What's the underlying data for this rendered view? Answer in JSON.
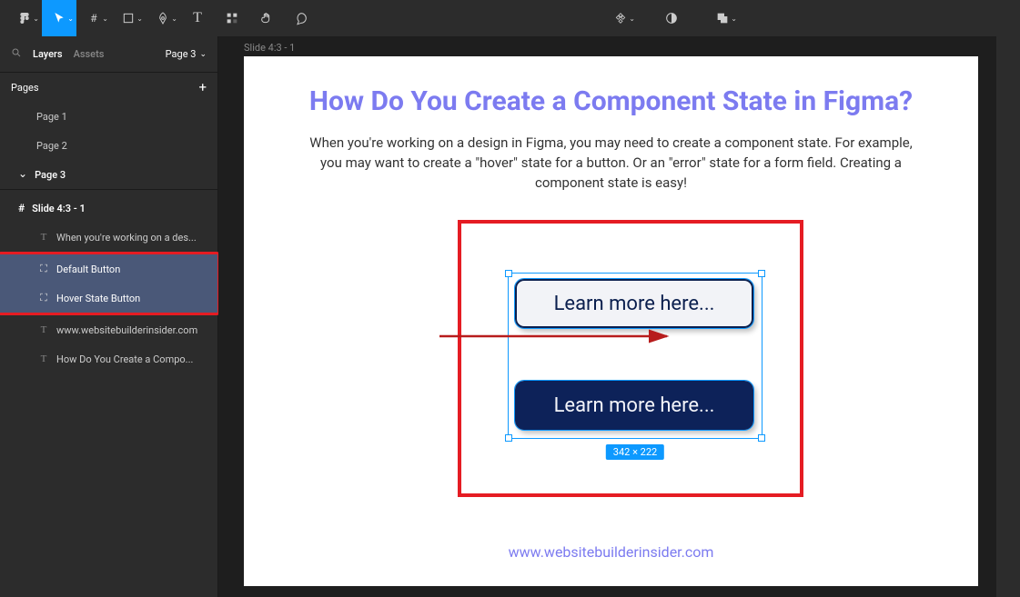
{
  "toolbar": {
    "tools": [
      "figma-menu",
      "move",
      "frame",
      "shape",
      "pen",
      "text",
      "resources",
      "hand",
      "comment"
    ]
  },
  "sidebar": {
    "tabs": {
      "layers": "Layers",
      "assets": "Assets"
    },
    "page_selector": "Page 3",
    "pages_header": "Pages",
    "pages": [
      "Page 1",
      "Page 2",
      "Page 3"
    ],
    "current_page_index": 2,
    "frame_name": "Slide 4:3 - 1",
    "layers": [
      {
        "type": "text",
        "label": "When you're working on a des...",
        "selected": false
      },
      {
        "type": "frame",
        "label": "Default Button",
        "selected": true
      },
      {
        "type": "frame",
        "label": "Hover State Button",
        "selected": true
      },
      {
        "type": "text",
        "label": "www.websitebuilderinsider.com",
        "selected": false
      },
      {
        "type": "text",
        "label": "How Do You Create a Compo...",
        "selected": false
      }
    ]
  },
  "canvas": {
    "frame_label": "Slide 4:3 - 1",
    "title": "How Do You Create a Component State in Figma?",
    "body": "When you're working on a design in Figma, you may need to create a component state. For example, you may want to create a \"hover\" state for a button. Or an \"error\" state for a form field. Creating a component state is easy!",
    "url": "www.websitebuilderinsider.com",
    "button_default_label": "Learn more here...",
    "button_hover_label": "Learn more here...",
    "selection_size": "342 × 222"
  }
}
